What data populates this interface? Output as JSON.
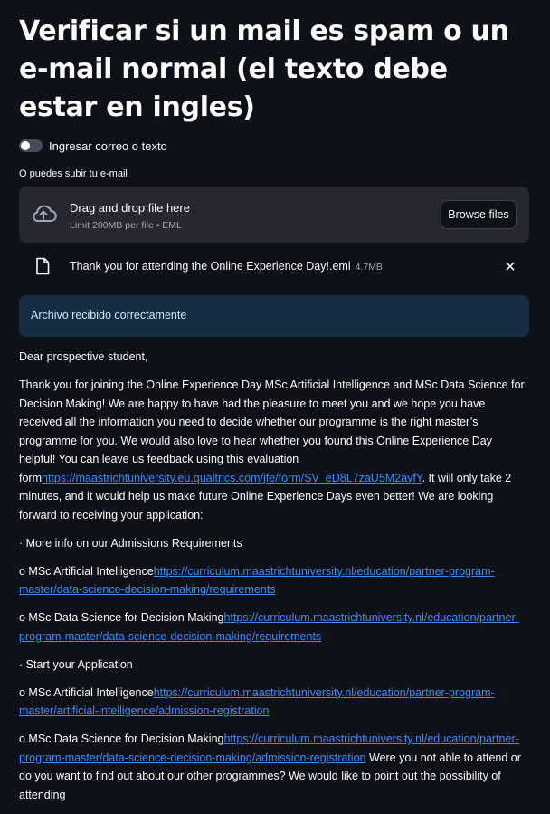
{
  "page": {
    "title": "Verificar si un mail es spam o un e-mail normal (el texto debe estar en ingles)"
  },
  "toggle": {
    "label": "Ingresar correo o texto",
    "checked": false
  },
  "uploader": {
    "label": "O puedes subir tu e-mail",
    "dropzone_title": "Drag and drop file here",
    "dropzone_limit": "Limit 200MB per file • EML",
    "browse_label": "Browse files",
    "icon": "cloud-upload-icon"
  },
  "uploaded_file": {
    "name": "Thank you for attending the Online Experience Day!.eml",
    "size": "4.7MB",
    "icon": "file-icon",
    "remove_icon": "close-icon",
    "remove_glyph": "✕"
  },
  "alert": {
    "text": "Archivo recibido correctamente"
  },
  "email": {
    "greeting": "Dear prospective student,",
    "para1_text": "Thank you for joining the Online Experience Day MSc Artificial Intelligence and MSc Data Science for Decision Making! We are happy to have had the pleasure to meet you and we hope you have received all the information you need to decide whether our programme is the right master’s programme for you. We would also love to hear whether you found this Online Experience Day helpful! You can leave us feedback using this evaluation form",
    "para1_link": "https://maastrichtuniversity.eu.qualtrics.com/jfe/form/SV_eD8L7zaU5M2ayfY",
    "para1_tail": ". It will only take 2 minutes, and it would help us make future Online Experience Days even better! We are looking forward to receiving your application:",
    "bullet1": "· More info on our Admissions Requirements",
    "item1_text": "o MSc Artificial Intelligence",
    "item1_link": "https://curriculum.maastrichtuniversity.nl/education/partner-program-master/data-science-decision-making/requirements",
    "item2_text": "o MSc Data Science for Decision Making",
    "item2_link": "https://curriculum.maastrichtuniversity.nl/education/partner-program-master/data-science-decision-making/requirements",
    "bullet2": "· Start your Application",
    "item3_text": "o MSc Artificial Intelligence",
    "item3_link": "https://curriculum.maastrichtuniversity.nl/education/partner-program-master/artificial-intelligence/admission-registration",
    "item4_text": "o MSc Data Science for Decision Making",
    "item4_link": "https://curriculum.maastrichtuniversity.nl/education/partner-program-master/data-science-decision-making/admission-registration",
    "item4_tail": " Were you not able to attend or do you want to find out about our other programmes? We would like to point out the possibility of attending"
  },
  "colors": {
    "background": "#0e1117",
    "widget": "#262730",
    "text": "#fafafa",
    "link": "#3a8dff",
    "info_bg": "#172d43",
    "info_text": "#c7ebff"
  }
}
